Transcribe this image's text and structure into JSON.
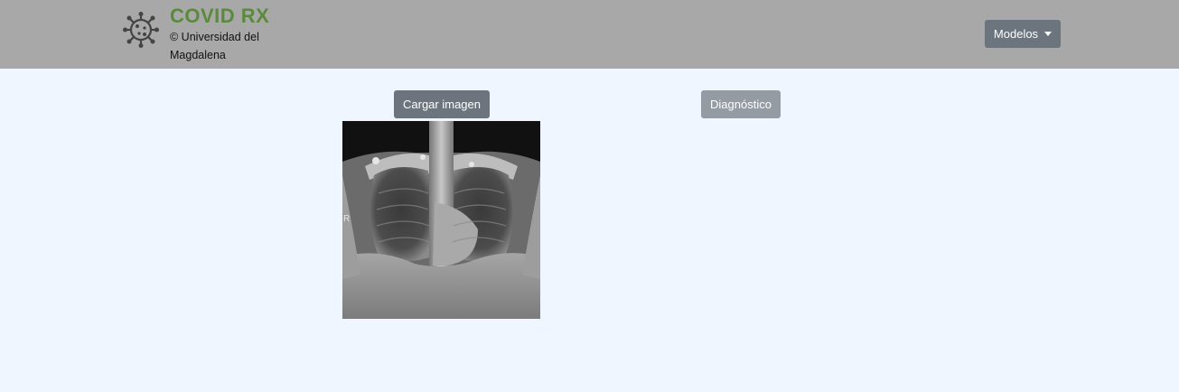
{
  "header": {
    "title": "COVID RX",
    "subtitle": "© Universidad del Magdalena",
    "logo_icon": "virus-icon",
    "menu_label": "Modelos",
    "title_color": "#5a8a3c",
    "bg_color": "#a8a8a8"
  },
  "main": {
    "upload_label": "Cargar imagen",
    "diagnosis_label": "Diagnóstico",
    "image_marker": "R"
  }
}
